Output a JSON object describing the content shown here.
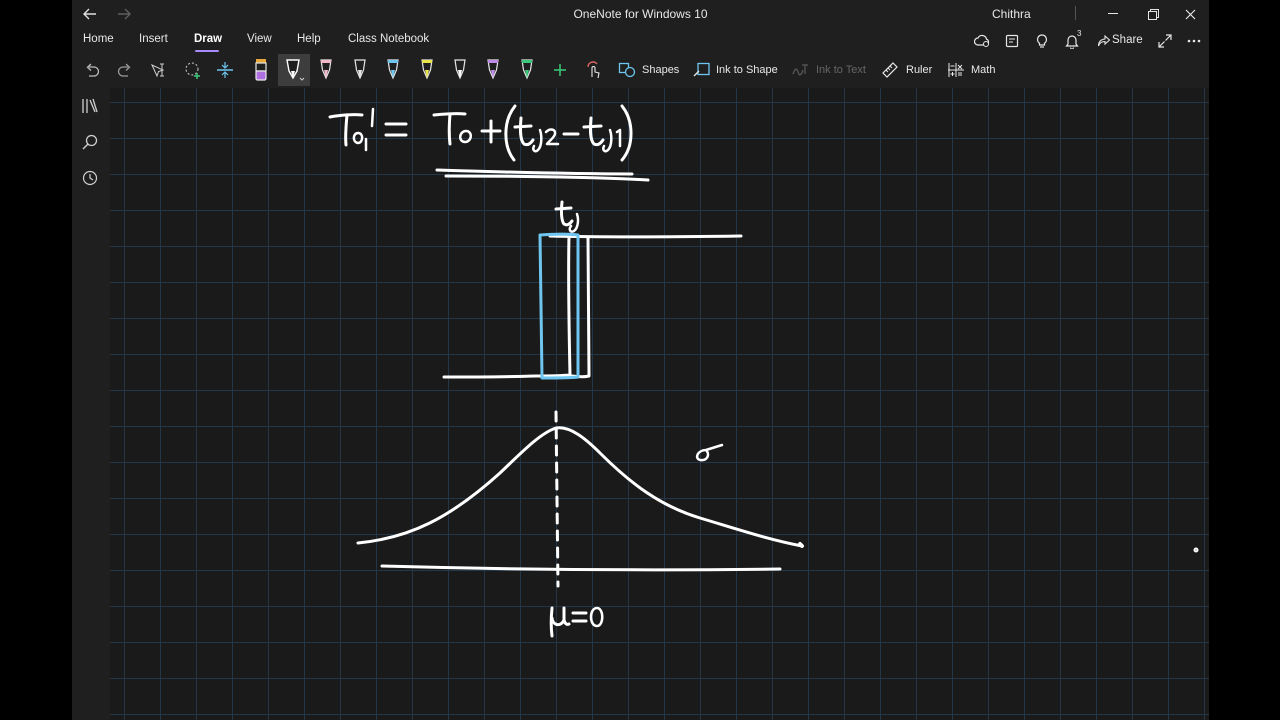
{
  "window": {
    "title": "OneNote for Windows 10",
    "user": "Chithra"
  },
  "menu": {
    "tabs": [
      "Home",
      "Insert",
      "Draw",
      "View",
      "Help",
      "Class Notebook"
    ],
    "active": "Draw",
    "notifications_count": "3",
    "share_label": "Share"
  },
  "toolbar": {
    "shapes_label": "Shapes",
    "ink_to_shape_label": "Ink to Shape",
    "ink_to_text_label": "Ink to Text",
    "ruler_label": "Ruler",
    "math_label": "Math",
    "pen_colors": [
      "#f2b8c8",
      "#ffffff",
      "#f2b8c8",
      "#6ec6f0",
      "#e8e64a",
      "#ffffff",
      "#c08ae8",
      "#3cc87a"
    ],
    "highlighter_color": "#b070e0",
    "accent_color": "#a78bfa"
  },
  "icons": {
    "rail": [
      "notebooks-icon",
      "search-icon",
      "recent-icon"
    ]
  }
}
